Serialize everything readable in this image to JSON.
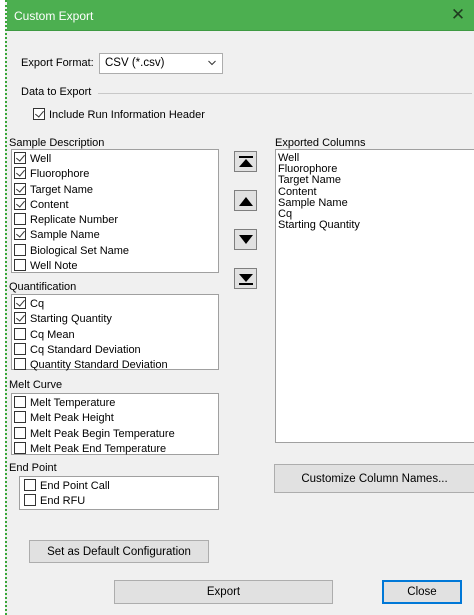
{
  "window": {
    "title": "Custom Export",
    "close_glyph": "✕"
  },
  "export_format": {
    "label": "Export Format:",
    "selected": "CSV (*.csv)"
  },
  "data_to_export": {
    "group_label": "Data to Export",
    "include_header": {
      "label": "Include Run Information Header",
      "checked": true
    }
  },
  "sample_description": {
    "label": "Sample Description",
    "items": [
      {
        "label": "Well",
        "checked": true
      },
      {
        "label": "Fluorophore",
        "checked": true
      },
      {
        "label": "Target Name",
        "checked": true
      },
      {
        "label": "Content",
        "checked": true
      },
      {
        "label": "Replicate Number",
        "checked": false
      },
      {
        "label": "Sample Name",
        "checked": true
      },
      {
        "label": "Biological Set Name",
        "checked": false
      },
      {
        "label": "Well Note",
        "checked": false
      }
    ]
  },
  "quantification": {
    "label": "Quantification",
    "items": [
      {
        "label": "Cq",
        "checked": true
      },
      {
        "label": "Starting Quantity",
        "checked": true
      },
      {
        "label": "Cq Mean",
        "checked": false
      },
      {
        "label": "Cq Standard Deviation",
        "checked": false
      },
      {
        "label": "Quantity Standard Deviation",
        "checked": false
      }
    ]
  },
  "melt_curve": {
    "label": "Melt Curve",
    "items": [
      {
        "label": "Melt Temperature",
        "checked": false
      },
      {
        "label": "Melt Peak Height",
        "checked": false
      },
      {
        "label": "Melt Peak Begin Temperature",
        "checked": false
      },
      {
        "label": "Melt Peak End Temperature",
        "checked": false
      }
    ]
  },
  "end_point": {
    "label": "End Point",
    "items": [
      {
        "label": "End Point Call",
        "checked": false
      },
      {
        "label": "End RFU",
        "checked": false
      }
    ]
  },
  "exported_columns": {
    "label": "Exported Columns",
    "items": [
      "Well",
      "Fluorophore",
      "Target Name",
      "Content",
      "Sample Name",
      "Cq",
      "Starting Quantity"
    ]
  },
  "buttons": {
    "customize": "Customize Column Names...",
    "set_default": "Set as Default Configuration",
    "export": "Export",
    "close": "Close"
  },
  "icons": {
    "move_top": "move-to-top-icon",
    "move_up": "move-up-icon",
    "move_down": "move-down-icon",
    "move_bottom": "move-to-bottom-icon"
  },
  "colors": {
    "titlebar": "#4caf50",
    "title_text": "#ffffff",
    "focus_border": "#0078d7"
  }
}
